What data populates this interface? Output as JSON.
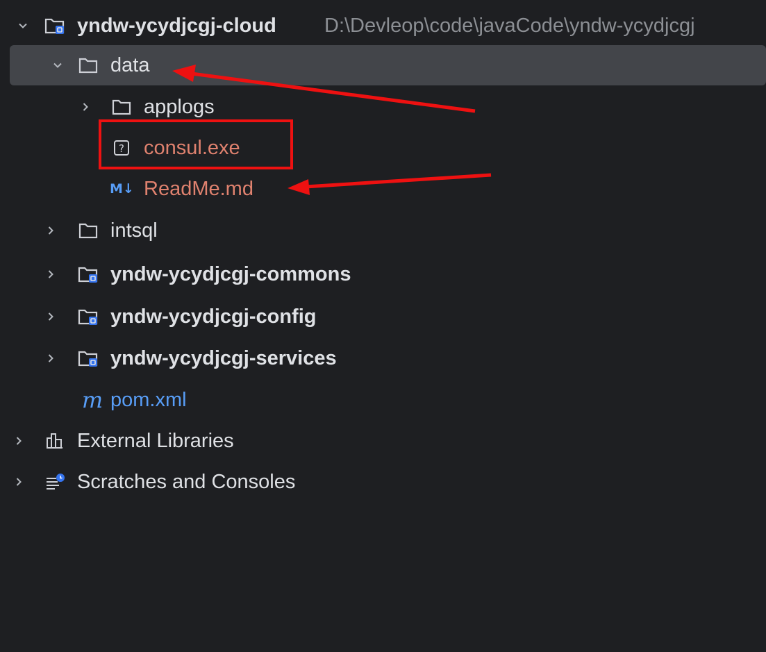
{
  "project": {
    "name": "yndw-ycydjcgj-cloud",
    "path": "D:\\Devleop\\code\\javaCode\\yndw-ycydjcgj"
  },
  "tree": {
    "data": "data",
    "applogs": "applogs",
    "consul": "consul.exe",
    "readme": "ReadMe.md",
    "readme_badge": "M↓",
    "intsql": "intsql",
    "commons": "yndw-ycydjcgj-commons",
    "config": "yndw-ycydjcgj-config",
    "services": "yndw-ycydjcgj-services",
    "pom": "pom.xml",
    "pom_badge": "m",
    "external": "External Libraries",
    "scratches": "Scratches and Consoles",
    "unknown_badge": "?"
  },
  "colors": {
    "background": "#1e1f22",
    "selection": "#43454a",
    "text": "#dfe1e5",
    "path": "#8c8f94",
    "untracked": "#e0826f",
    "maven": "#589df6",
    "annotation": "#ee1111",
    "module_badge": "#3574f0"
  }
}
